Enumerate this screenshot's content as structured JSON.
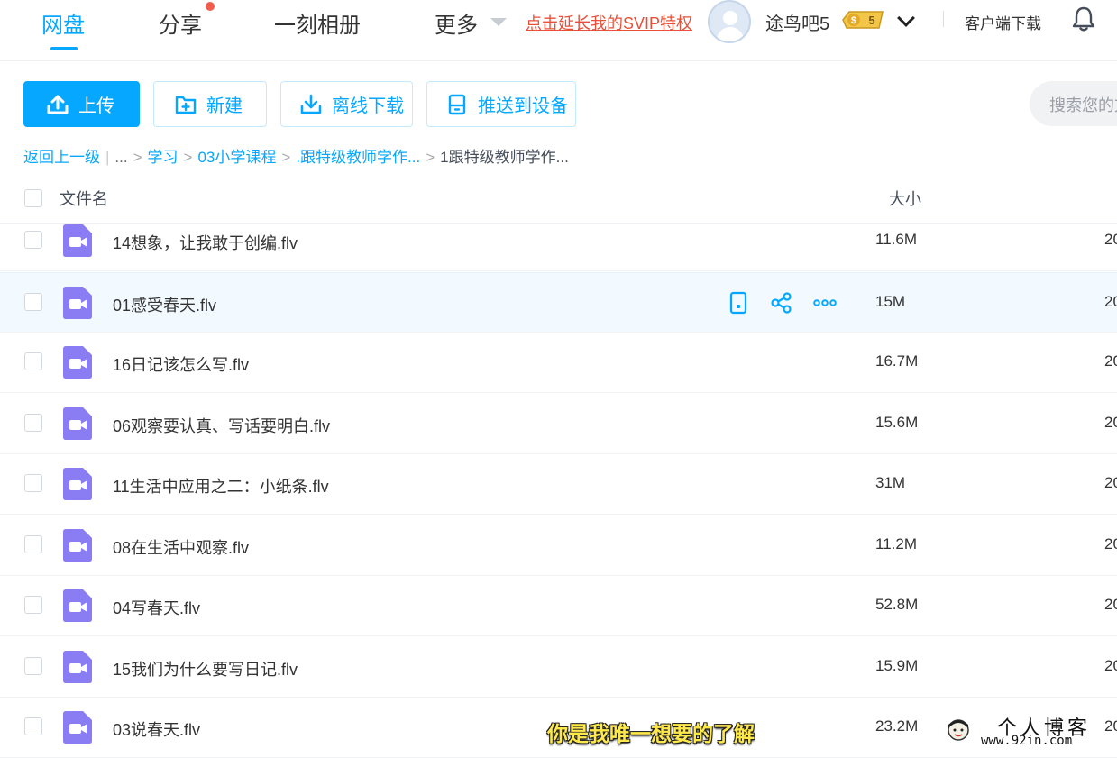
{
  "nav": {
    "items": [
      {
        "label": "网盘",
        "active": true
      },
      {
        "label": "分享",
        "has_dot": true
      },
      {
        "label": "一刻相册"
      },
      {
        "label": "更多"
      }
    ],
    "promo_link": "点击延长我的SVIP特权",
    "username": "途鸟吧5",
    "vip_level": "5",
    "client_download": "客户端下载"
  },
  "toolbar": {
    "upload": "上传",
    "new": "新建",
    "offline_download": "离线下载",
    "push_to_device": "推送到设备",
    "search_placeholder": "搜索您的文件"
  },
  "breadcrumb": {
    "back": "返回上一级",
    "ellipsis": "...",
    "items": [
      "学习",
      "03小学课程",
      ".跟特级教师学作..."
    ],
    "current": "1跟特级教师学作..."
  },
  "table": {
    "col_name": "文件名",
    "col_size": "大小",
    "rows": [
      {
        "name": "14想象，让我敢于创编.flv",
        "size": "11.6M",
        "date": "20"
      },
      {
        "name": "01感受春天.flv",
        "size": "15M",
        "date": "20",
        "hover": true
      },
      {
        "name": "16日记该怎么写.flv",
        "size": "16.7M",
        "date": "20"
      },
      {
        "name": "06观察要认真、写话要明白.flv",
        "size": "15.6M",
        "date": "20"
      },
      {
        "name": "11生活中应用之二：小纸条.flv",
        "size": "31M",
        "date": "20"
      },
      {
        "name": "08在生活中观察.flv",
        "size": "11.2M",
        "date": "20"
      },
      {
        "name": "04写春天.flv",
        "size": "52.8M",
        "date": "20"
      },
      {
        "name": "15我们为什么要写日记.flv",
        "size": "15.9M",
        "date": "20"
      },
      {
        "name": "03说春天.flv",
        "size": "23.2M",
        "date": "20"
      }
    ]
  },
  "overlay": {
    "subtitle": "你是我唯一想要的了解",
    "watermark_title": "个人博客",
    "watermark_url": "www.92in.com"
  },
  "colors": {
    "accent": "#06a7ff",
    "file_icon": "#8a7cf2",
    "promo": "#e8503a"
  }
}
